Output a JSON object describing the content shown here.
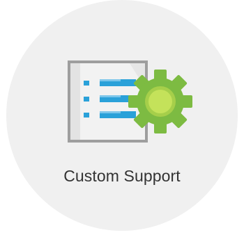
{
  "tile": {
    "label": "Custom Support",
    "icon": "document-gear-icon"
  },
  "colors": {
    "tile_background": "#f0f0f0",
    "label_text": "#333333",
    "document_fill": "#f2f2f2",
    "document_border": "#9e9e9e",
    "list_blue": "#2aa1d9",
    "gear_green": "#7dbb42",
    "gear_hub": "#c4e25a"
  }
}
